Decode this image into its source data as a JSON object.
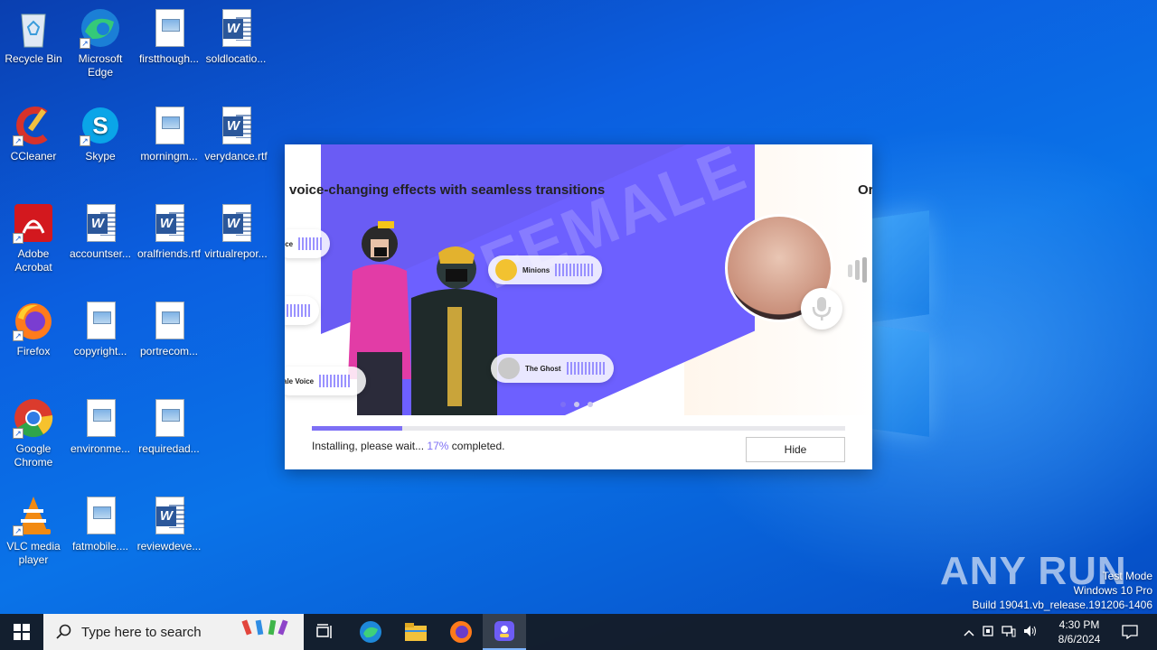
{
  "desktop": {
    "icons": [
      {
        "label": "Recycle Bin",
        "icon": "recycle-bin-icon"
      },
      {
        "label": "Microsoft Edge",
        "icon": "edge-icon"
      },
      {
        "label": "firstthough...",
        "icon": "image-file-icon"
      },
      {
        "label": "soldlocatio...",
        "icon": "word-doc-icon"
      },
      {
        "label": "CCleaner",
        "icon": "ccleaner-icon"
      },
      {
        "label": "Skype",
        "icon": "skype-icon"
      },
      {
        "label": "morningm...",
        "icon": "image-file-icon"
      },
      {
        "label": "verydance.rtf",
        "icon": "word-doc-icon"
      },
      {
        "label": "Adobe Acrobat",
        "icon": "acrobat-icon"
      },
      {
        "label": "accountser...",
        "icon": "word-doc-icon"
      },
      {
        "label": "oralfriends.rtf",
        "icon": "word-doc-icon"
      },
      {
        "label": "virtualrepor...",
        "icon": "word-doc-icon"
      },
      {
        "label": "Firefox",
        "icon": "firefox-icon"
      },
      {
        "label": "copyright...",
        "icon": "image-file-icon"
      },
      {
        "label": "portrecom...",
        "icon": "image-file-icon"
      },
      {
        "label": "Google Chrome",
        "icon": "chrome-icon"
      },
      {
        "label": "environme...",
        "icon": "image-file-icon"
      },
      {
        "label": "requiredad...",
        "icon": "image-file-icon"
      },
      {
        "label": "VLC media player",
        "icon": "vlc-icon"
      },
      {
        "label": "fatmobile....",
        "icon": "image-file-icon"
      },
      {
        "label": "reviewdeve...",
        "icon": "word-doc-icon"
      }
    ]
  },
  "installer": {
    "banner_title": "voice-changing effects with seamless transitions",
    "banner_title_next": "Or",
    "chips": [
      {
        "label": "ice"
      },
      {
        "label": "Minions"
      },
      {
        "label": "The Ghost"
      },
      {
        "label": "ale Voice"
      }
    ],
    "watermark_text": "FEMALE",
    "progress_percent": 17,
    "status_prefix": "Installing, please wait... ",
    "status_percent": "17%",
    "status_suffix": " completed.",
    "hide_label": "Hide",
    "accent": "#7d6ff5"
  },
  "watermark": {
    "brand": "ANY RUN",
    "line1": "Test Mode",
    "line2": "Windows 10 Pro",
    "line3": "Build 19041.vb_release.191206-1406"
  },
  "taskbar": {
    "search_placeholder": "Type here to search",
    "time": "4:30 PM",
    "date": "8/6/2024"
  }
}
